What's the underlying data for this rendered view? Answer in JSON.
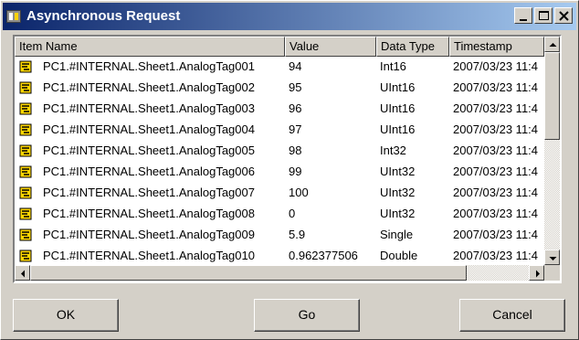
{
  "window": {
    "title": "Asynchronous Request",
    "app_icon": "app-icon",
    "controls": [
      "minimize-icon",
      "maximize-icon",
      "close-icon"
    ]
  },
  "list": {
    "columns": [
      "Item Name",
      "Value",
      "Data Type",
      "Timestamp"
    ],
    "rows": [
      {
        "name": "PC1.#INTERNAL.Sheet1.AnalogTag001",
        "value": "94",
        "type": "Int16",
        "timestamp": "2007/03/23 11:4"
      },
      {
        "name": "PC1.#INTERNAL.Sheet1.AnalogTag002",
        "value": "95",
        "type": "UInt16",
        "timestamp": "2007/03/23 11:4"
      },
      {
        "name": "PC1.#INTERNAL.Sheet1.AnalogTag003",
        "value": "96",
        "type": "UInt16",
        "timestamp": "2007/03/23 11:4"
      },
      {
        "name": "PC1.#INTERNAL.Sheet1.AnalogTag004",
        "value": "97",
        "type": "UInt16",
        "timestamp": "2007/03/23 11:4"
      },
      {
        "name": "PC1.#INTERNAL.Sheet1.AnalogTag005",
        "value": "98",
        "type": "Int32",
        "timestamp": "2007/03/23 11:4"
      },
      {
        "name": "PC1.#INTERNAL.Sheet1.AnalogTag006",
        "value": "99",
        "type": "UInt32",
        "timestamp": "2007/03/23 11:4"
      },
      {
        "name": "PC1.#INTERNAL.Sheet1.AnalogTag007",
        "value": "100",
        "type": "UInt32",
        "timestamp": "2007/03/23 11:4"
      },
      {
        "name": "PC1.#INTERNAL.Sheet1.AnalogTag008",
        "value": "0",
        "type": "UInt32",
        "timestamp": "2007/03/23 11:4"
      },
      {
        "name": "PC1.#INTERNAL.Sheet1.AnalogTag009",
        "value": "5.9",
        "type": "Single",
        "timestamp": "2007/03/23 11:4"
      },
      {
        "name": "PC1.#INTERNAL.Sheet1.AnalogTag010",
        "value": "0.962377506",
        "type": "Double",
        "timestamp": "2007/03/23 11:4"
      }
    ],
    "row_icon": "tag-icon"
  },
  "buttons": {
    "ok": "OK",
    "go": "Go",
    "cancel": "Cancel"
  }
}
